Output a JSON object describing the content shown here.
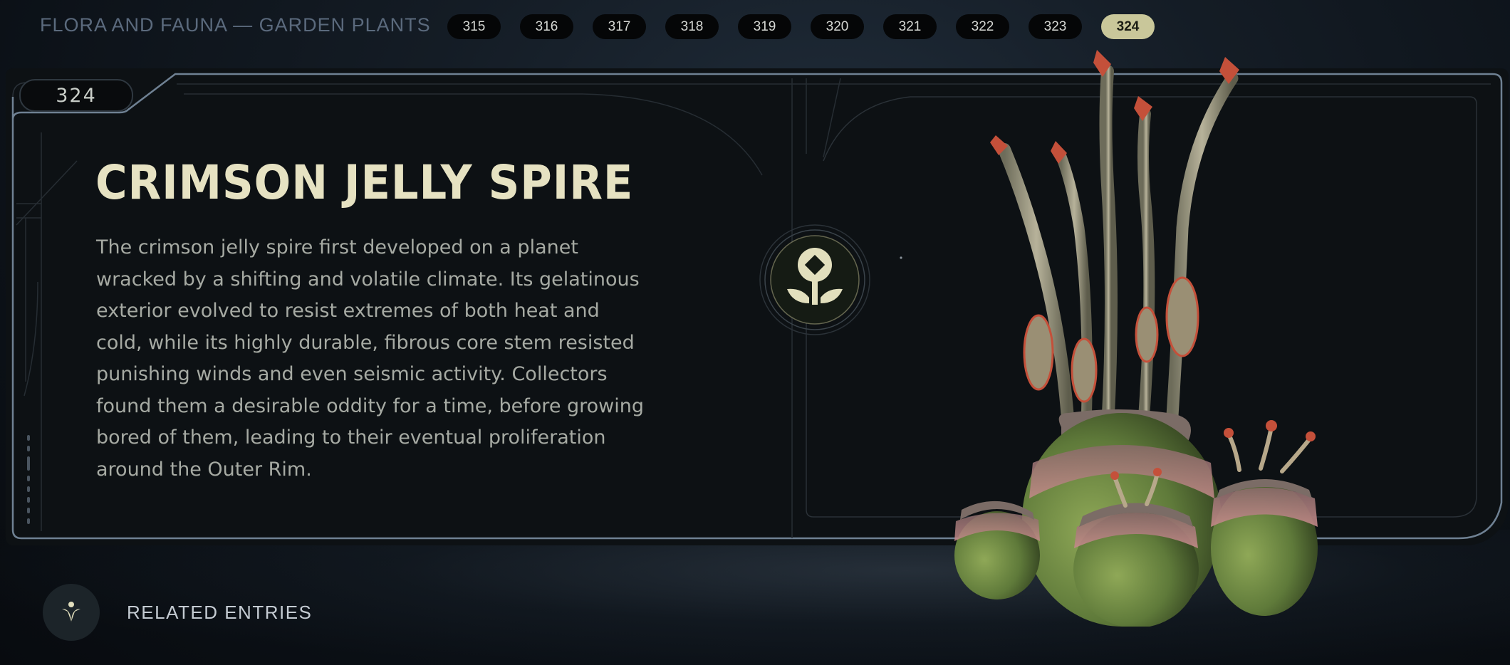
{
  "header": {
    "breadcrumb": "FLORA AND FAUNA — GARDEN PLANTS",
    "pages": [
      "315",
      "316",
      "317",
      "318",
      "319",
      "320",
      "321",
      "322",
      "323",
      "324"
    ],
    "active_page": "324",
    "active_color": "#c9c79a"
  },
  "entry": {
    "number": "324",
    "title": "CRIMSON JELLY SPIRE",
    "description_lines": [
      "The crimson jelly spire first developed on a planet",
      "wracked by a shifting and volatile climate. Its gelatinous",
      "exterior evolved to resist extremes of both heat and",
      "cold, while its highly durable, fibrous core stem resisted",
      "punishing winds and even seismic activity. Collectors",
      "found them a desirable oddity for a time, before growing",
      "bored of them, leading to their eventual proliferation",
      "around the Outer Rim."
    ],
    "category_icon": "plant-sprout-icon",
    "image": "crimson-jelly-spire-plant"
  },
  "footer": {
    "related_label": "RELATED ENTRIES",
    "related_icon": "related-entries-icon"
  },
  "colors": {
    "title": "#e6e2c2",
    "text": "#a6aaa3",
    "panel": "#0d1114",
    "frame": "#6f8193"
  }
}
